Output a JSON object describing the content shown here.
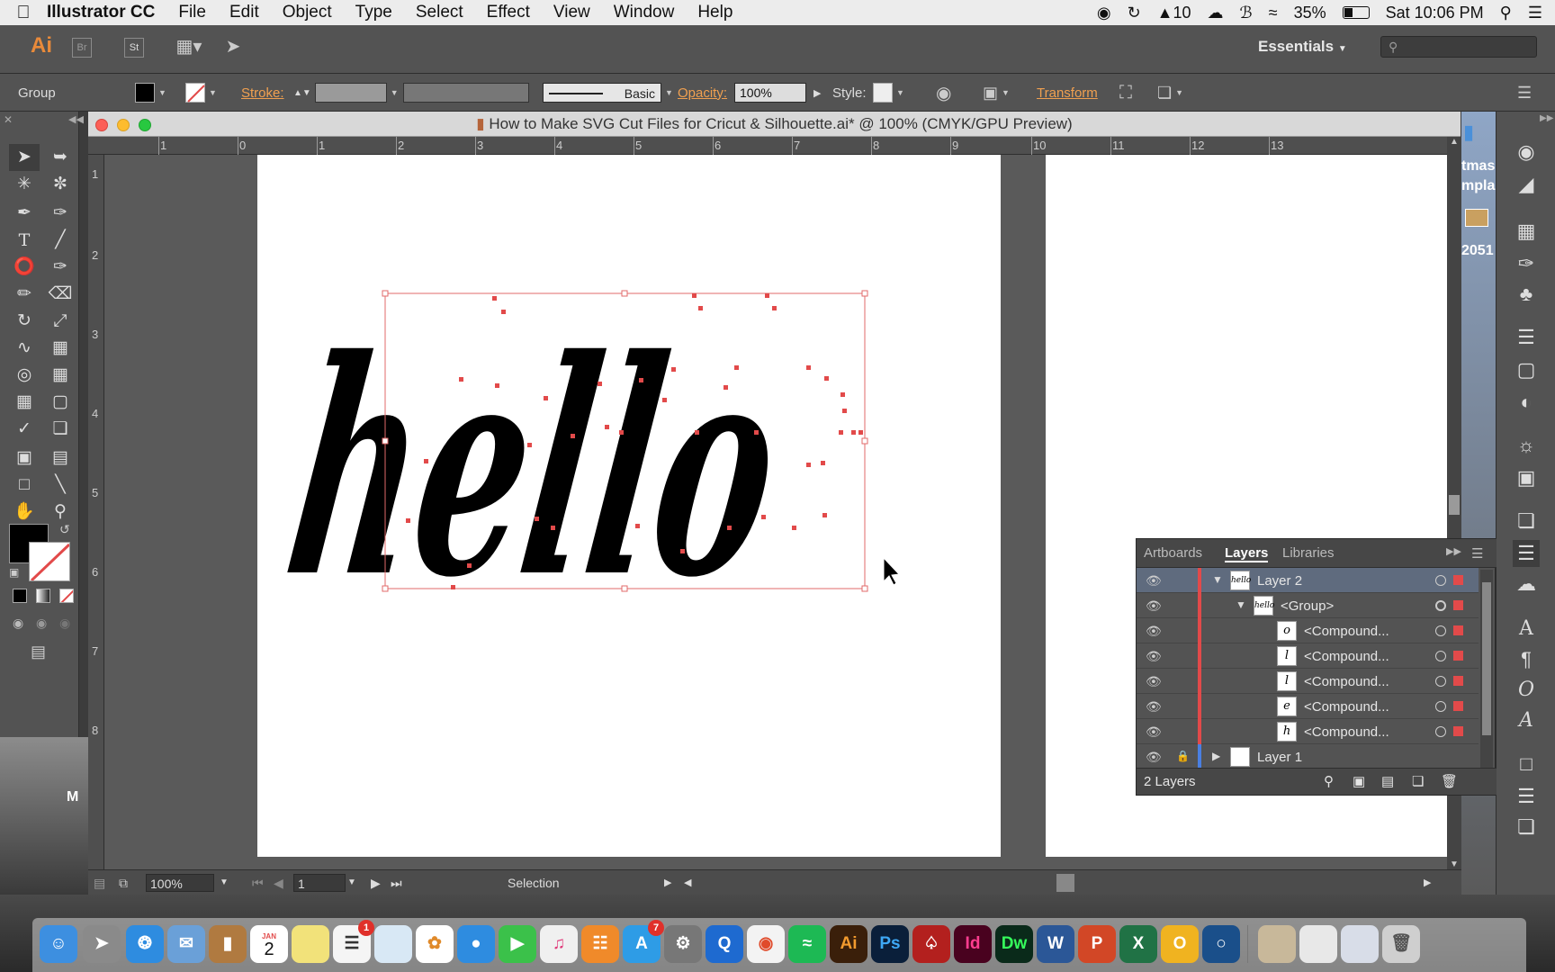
{
  "menubar": {
    "apple": "",
    "app_name": "Illustrator CC",
    "items": [
      "File",
      "Edit",
      "Object",
      "Type",
      "Select",
      "Effect",
      "View",
      "Window",
      "Help"
    ],
    "status": {
      "adobe_count": "10",
      "battery": "35%",
      "battery_fraction": 0.35,
      "datetime": "Sat 10:06 PM"
    }
  },
  "appbar": {
    "logo": "Ai",
    "bridge": "Br",
    "stock": "St",
    "workspace": "Essentials"
  },
  "control": {
    "selection_type": "Group",
    "stroke_label": "Stroke:",
    "brush": "Basic",
    "opacity_label": "Opacity:",
    "opacity_value": "100%",
    "style_label": "Style:",
    "transform_label": "Transform"
  },
  "document": {
    "title": "How to Make SVG Cut Files for Cricut & Silhouette.ai* @ 100% (CMYK/GPU Preview)",
    "artwork_text": "hello"
  },
  "rulers": {
    "top": [
      "1",
      "0",
      "1",
      "2",
      "3",
      "4",
      "5",
      "6",
      "7",
      "8",
      "9",
      "10",
      "11",
      "12",
      "13"
    ],
    "left": [
      "1",
      "2",
      "3",
      "4",
      "5",
      "6",
      "7",
      "8"
    ]
  },
  "statusbar": {
    "zoom": "100%",
    "page": "1",
    "tool": "Selection"
  },
  "layers_panel": {
    "tabs": [
      "Artboards",
      "Layers",
      "Libraries"
    ],
    "rows": [
      {
        "name": "Layer 2",
        "thumb": "hello",
        "indent": 0,
        "expanded": true
      },
      {
        "name": "<Group>",
        "thumb": "hello",
        "indent": 1,
        "expanded": true
      },
      {
        "name": "<Compound...",
        "thumb": "o",
        "indent": 2
      },
      {
        "name": "<Compound...",
        "thumb": "l",
        "indent": 2
      },
      {
        "name": "<Compound...",
        "thumb": "l",
        "indent": 2
      },
      {
        "name": "<Compound...",
        "thumb": "e",
        "indent": 2
      },
      {
        "name": "<Compound...",
        "thumb": "h",
        "indent": 2
      },
      {
        "name": "Layer 1",
        "thumb": "",
        "indent": 0,
        "expanded": false
      }
    ],
    "footer": "2 Layers"
  },
  "desktop": {
    "right_text": [
      "tmas",
      "mpla",
      "2051"
    ],
    "left_text": "M"
  },
  "dock": {
    "calendar_month": "JAN",
    "calendar_day": "2",
    "badges": {
      "reminders": "1",
      "appstore": "7"
    },
    "apps": [
      "Ai",
      "Ps",
      "Id",
      "Dw",
      "W",
      "P",
      "X",
      "O"
    ]
  },
  "colors": {
    "accent_orange": "#f0a050",
    "selection_red": "#e24a4a",
    "panel_bg": "#535353"
  }
}
